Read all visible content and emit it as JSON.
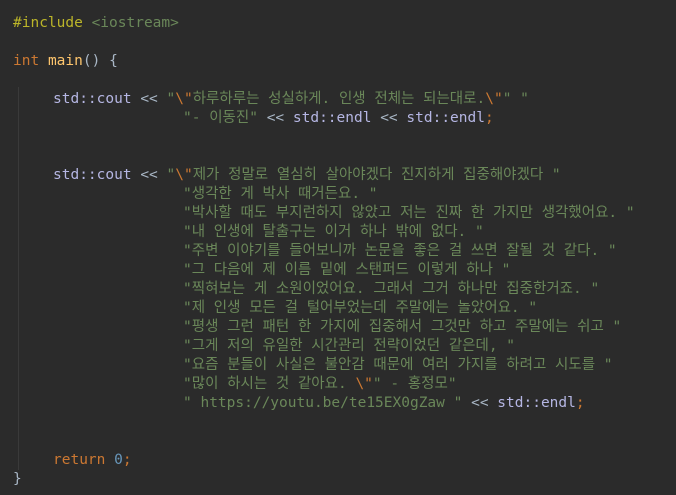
{
  "editor": {
    "colors": {
      "background": "#2b2b2b",
      "keyword": "#cc7832",
      "function": "#ffc66d",
      "string": "#6a8759",
      "number": "#6897bb",
      "identifier": "#b5b6e3",
      "text": "#a9b7c6",
      "preprocessor": "#bbb529"
    },
    "code": {
      "include": "#include",
      "include_header": "<iostream>",
      "int_kw": "int",
      "main_name": "main",
      "main_parens": "()",
      "open_brace": "{",
      "cout1": "std::cout",
      "op": "<<",
      "quote_open": "\"",
      "esc_quote": "\\\"",
      "s1_text": "하루하루는 성실하게. 인생 전체는 되는대로.",
      "s1_tail": "\"",
      "s1_space": " \"",
      "s2_text": "\"- 이동진\"",
      "endl": "std::endl",
      "semicolon": ";",
      "cout2": "std::cout",
      "s3_text": "제가 정말로 열심히 살아야겠다 진지하게 집중해야겠다 \"",
      "lines": [
        "\"생각한 게 박사 때거든요. \"",
        "\"박사할 때도 부지런하지 않았고 저는 진짜 한 가지만 생각했어요. \"",
        "\"내 인생에 탈출구는 이거 하나 밖에 없다. \"",
        "\"주변 이야기를 들어보니까 논문을 좋은 걸 쓰면 잘될 것 같다. \"",
        "\"그 다음에 제 이름 밑에 스탠퍼드 이렇게 하나 \"",
        "\"찍혀보는 게 소원이었어요. 그래서 그거 하나만 집중한거죠. \"",
        "\"제 인생 모든 걸 털어부었는데 주말에는 놀았어요. \"",
        "\"평생 그런 패턴 한 가지에 집중해서 그것만 하고 주말에는 쉬고 \"",
        "\"그게 저의 유일한 시간관리 전략이었던 같은데, \"",
        "\"요즘 분들이 사실은 불안감 때문에 여러 가지를 하려고 시도를 \"",
        "\"많이 하시는 것 같아요. "
      ],
      "last_str_tail": "\" - 홍정모\"",
      "url_str": "\" https://youtu.be/te15EX0gZaw \"",
      "return_kw": "return",
      "zero": "0",
      "close_brace": "}"
    }
  }
}
